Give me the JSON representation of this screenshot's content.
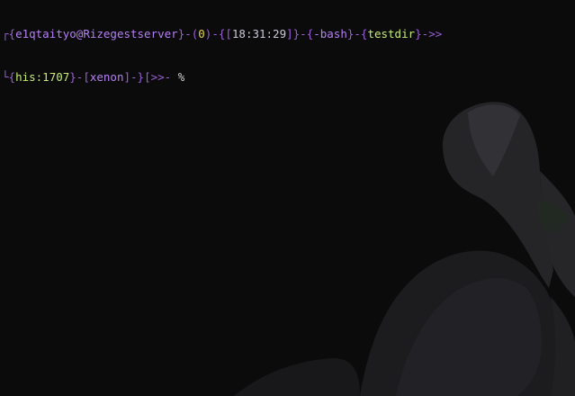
{
  "colors": {
    "background": "#0b0b0c",
    "bracket_purple": "#9b5fd6",
    "user_host": "#b480f2",
    "exit_code": "#e0d24a",
    "time": "#c9c9d8",
    "shell": "#b480f2",
    "dir": "#c6ec76",
    "history": "#c6ec76",
    "session": "#b480f2",
    "prompt_symbol": "#d2d2d2"
  },
  "prompt": {
    "line1": [
      {
        "text": "┌{",
        "color": "#9b5fd6"
      },
      {
        "text": "e1qtaityo@Rizegestserver",
        "color": "#b480f2"
      },
      {
        "text": "}-(",
        "color": "#9b5fd6"
      },
      {
        "text": "0",
        "color": "#e0d24a"
      },
      {
        "text": ")-{[",
        "color": "#9b5fd6"
      },
      {
        "text": "18:31:29",
        "color": "#c9c9d8"
      },
      {
        "text": "]}-{",
        "color": "#9b5fd6"
      },
      {
        "text": "-bash",
        "color": "#b480f2"
      },
      {
        "text": "}-{",
        "color": "#9b5fd6"
      },
      {
        "text": "testdir",
        "color": "#c6ec76"
      },
      {
        "text": "}->>",
        "color": "#9b5fd6"
      }
    ],
    "line2": [
      {
        "text": "└{",
        "color": "#9b5fd6"
      },
      {
        "text": "his:1707",
        "color": "#c6ec76"
      },
      {
        "text": "}-[",
        "color": "#9b5fd6"
      },
      {
        "text": "xenon",
        "color": "#b480f2"
      },
      {
        "text": "]-}[>>-",
        "color": "#9b5fd6"
      },
      {
        "text": " %",
        "color": "#d2d2d2"
      }
    ]
  }
}
